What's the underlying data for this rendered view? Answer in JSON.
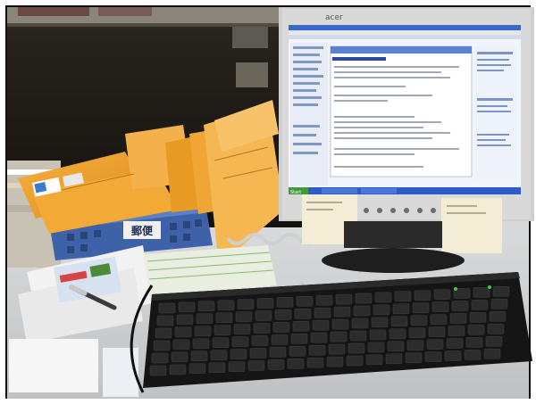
{
  "monitor": {
    "brand": "acer",
    "taskbar": {
      "start_label": "Start"
    }
  },
  "bin": {
    "label": "郵便"
  },
  "colors": {
    "frame": "#1a1a1a",
    "desk": "#e6e6e6",
    "envelope": "#f0a02a",
    "bin": "#3d62a8",
    "keyboard": "#151515",
    "monitor_bezel": "#d0d0d0",
    "screen": "#f1f4fb",
    "taskbar": "#2d5cc9",
    "sticky_note": "#f3edd6"
  }
}
